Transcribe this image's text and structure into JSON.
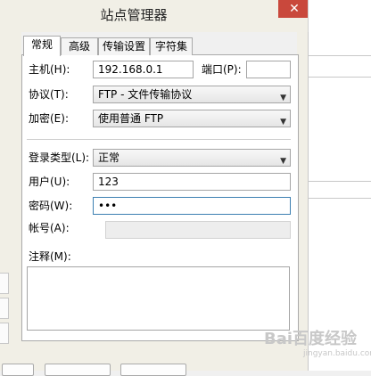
{
  "window": {
    "title": "站点管理器",
    "close_glyph": "✕"
  },
  "tabs": [
    {
      "label": "常规",
      "active": true
    },
    {
      "label": "高级",
      "active": false
    },
    {
      "label": "传输设置",
      "active": false
    },
    {
      "label": "字符集",
      "active": false
    }
  ],
  "form": {
    "host_label": "主机(H):",
    "host_value": "192.168.0.1",
    "port_label": "端口(P):",
    "port_value": "",
    "protocol_label": "协议(T):",
    "protocol_value": "FTP - 文件传输协议",
    "encryption_label": "加密(E):",
    "encryption_value": "使用普通 FTP",
    "logon_type_label": "登录类型(L):",
    "logon_type_value": "正常",
    "user_label": "用户(U):",
    "user_value": "123",
    "password_label": "密码(W):",
    "password_value": "•••",
    "account_label": "帐号(A):",
    "account_value": "",
    "notes_label": "注释(M):"
  },
  "watermark": {
    "text": "Bai百度经验",
    "url": "jingyan.baidu.com"
  },
  "icons": {
    "dropdown": "chevron-down-icon",
    "close": "close-icon"
  }
}
